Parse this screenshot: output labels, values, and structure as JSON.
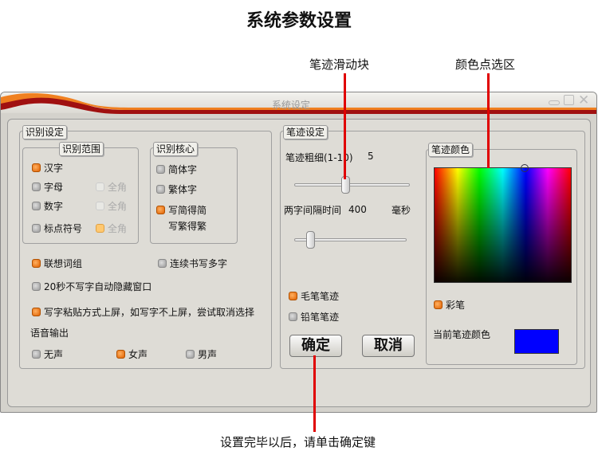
{
  "page_title": "系统参数设置",
  "annotations": {
    "slider": "笔迹滑动块",
    "color_area": "颜色点选区",
    "confirm_hint": "设置完毕以后，请单击确定键"
  },
  "window": {
    "title": "系统设定"
  },
  "recognition": {
    "legend": "识别设定",
    "range": {
      "legend": "识别范围",
      "items": [
        {
          "label": "汉字",
          "checked": true
        },
        {
          "label": "字母",
          "checked": false
        },
        {
          "label": "数字",
          "checked": false
        },
        {
          "label": "标点符号",
          "checked": false
        }
      ],
      "fullwidth": [
        {
          "label": "全角",
          "checked": false
        },
        {
          "label": "全角",
          "checked": false
        },
        {
          "label": "全角",
          "checked": true
        }
      ]
    },
    "core": {
      "legend": "识别核心",
      "items": [
        {
          "label": "简体字",
          "checked": false
        },
        {
          "label": "繁体字",
          "checked": false
        },
        {
          "label": "写简得简",
          "checked": true
        }
      ],
      "sub": "写繁得繁"
    },
    "associate": "联想词组",
    "continuous": "连续书写多字",
    "autohide": "20秒不写字自动隐藏窗口",
    "paste": "写字粘贴方式上屏，如写字不上屏，尝试取消选择",
    "voice": {
      "label": "语音输出",
      "options": [
        {
          "label": "无声",
          "checked": false
        },
        {
          "label": "女声",
          "checked": true
        },
        {
          "label": "男声",
          "checked": false
        }
      ]
    }
  },
  "stroke": {
    "legend": "笔迹设定",
    "width_label": "笔迹粗细(1-10)",
    "width_value": "5",
    "interval_label": "两字间隔时间",
    "interval_value": "400",
    "interval_unit": "毫秒",
    "brush": "毛笔笔迹",
    "pencil": "铅笔笔迹",
    "color": {
      "legend": "笔迹颜色",
      "rainbow": "彩笔",
      "current_label": "当前笔迹颜色",
      "current": "#0000ff"
    },
    "ok": "确定",
    "cancel": "取消"
  }
}
